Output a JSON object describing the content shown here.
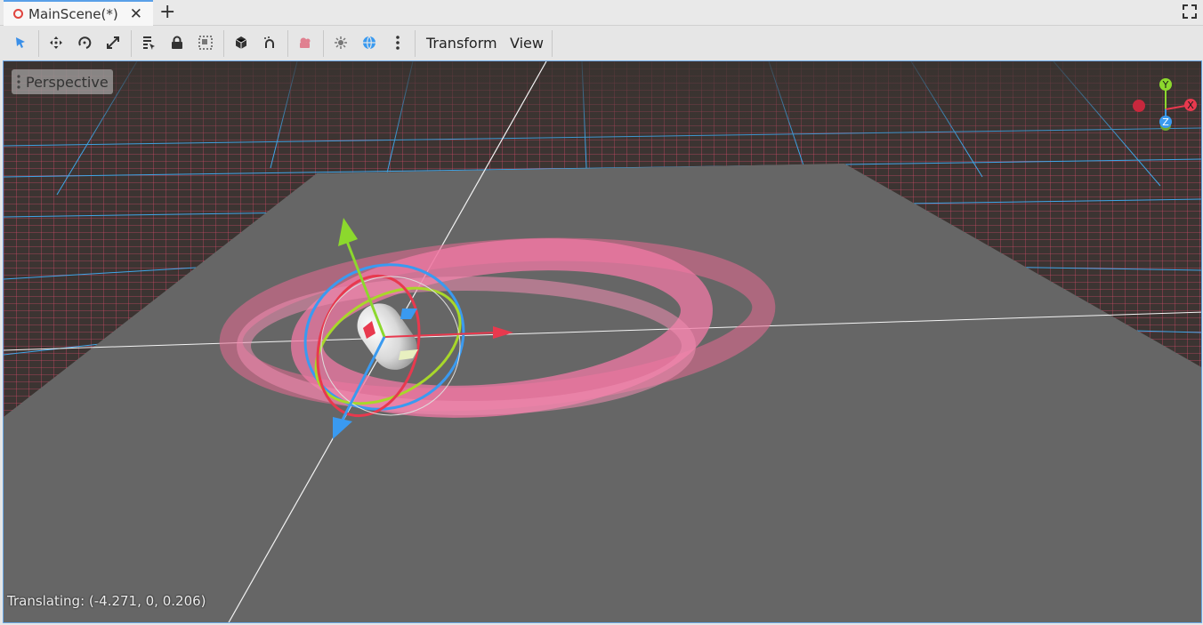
{
  "tab": {
    "title": "MainScene(*)",
    "close_icon": "close-icon",
    "add_icon": "plus-icon"
  },
  "toolbar": {
    "buttons": [
      "select-icon",
      "move-icon",
      "rotate-icon",
      "scale-icon",
      "list-select-icon",
      "lock-icon",
      "group-icon",
      "snap-icon",
      "local-space-icon",
      "camera-icon",
      "sun-icon",
      "environment-icon",
      "more-icon"
    ],
    "menus": {
      "transform": "Transform",
      "view": "View"
    }
  },
  "viewport": {
    "perspective_label": "Perspective",
    "status_text": "Translating: (-4.271, 0, 0.206)",
    "gizmo": {
      "y": "Y",
      "x": "X",
      "z": "Z"
    }
  },
  "colors": {
    "accent": "#4a9ff0",
    "x_axis": "#e8394e",
    "y_axis": "#8cd82d",
    "z_axis": "#3a9af0",
    "grid": "#e05a78",
    "floor": "#666666"
  }
}
